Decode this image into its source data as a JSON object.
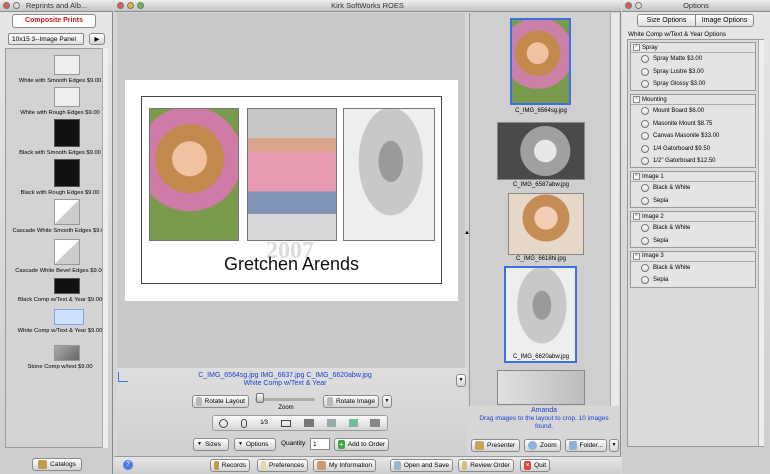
{
  "left_window": {
    "title": "Reprints and Alb...",
    "tab": "Composite Prints",
    "dropdown": "10x15 3--Image Panel",
    "catalogs_btn": "Catalogs",
    "items": [
      {
        "label": "White with Smooth Edges $9.00",
        "style": "white"
      },
      {
        "label": "White with Rough Edges $9.00",
        "style": "white"
      },
      {
        "label": "Black with Smooth Edges $9.00",
        "style": "black"
      },
      {
        "label": "Black with Rough Edges $9.00",
        "style": "black"
      },
      {
        "label": "Cascade White Smooth Edges $9.00",
        "style": "cascade"
      },
      {
        "label": "Cascade White Bevel Edges $9.00",
        "style": "cascade"
      },
      {
        "label": "Black Comp w/Text & Year $9.00",
        "style": "black-text"
      },
      {
        "label": "White Comp w/Text & Year $9.00",
        "style": "white-text"
      },
      {
        "label": "Stone Comp w/text $9.00",
        "style": "stone"
      }
    ]
  },
  "main_window": {
    "title": "Kirk SoftWorks ROES",
    "composite": {
      "name": "Gretchen Arends",
      "year": "2007"
    },
    "info": {
      "files": "C_IMG_6564sg.jpg  IMG_6637.jpg  C_IMG_6620abw.jpg",
      "layout": "White Comp w/Text & Year"
    },
    "controls": {
      "rotate_layout": "Rotate Layout",
      "zoom": "Zoom",
      "rotate_image": "Rotate Image",
      "sizes": "Sizes",
      "options": "Options",
      "quantity_label": "Quantity",
      "quantity": "1",
      "add_to_order": "Add to Order"
    },
    "strip": [
      {
        "label": "C_IMG_6564sg.jpg"
      },
      {
        "label": "C_IMG_6587abw.jpg"
      },
      {
        "label": "C_IMG_6618hi.jpg"
      },
      {
        "label": "C_IMG_6620abw.jpg"
      }
    ],
    "status": {
      "name": "Amanda",
      "text": "Drag images to the layout to crop. 10 images found."
    },
    "strip_buttons": {
      "presenter": "Presenter",
      "zoom": "Zoom",
      "folder": "Folder..."
    },
    "bottom": {
      "records": "Records",
      "preferences": "Preferences",
      "my_information": "My Information",
      "open_save": "Open and Save",
      "review_order": "Review Order",
      "quit": "Quit"
    }
  },
  "options_window": {
    "title": "Options",
    "tabs": [
      "Size Options",
      "Image Options"
    ],
    "section": "White Comp w/Text & Year Options",
    "groups": [
      {
        "name": "Spray",
        "options": [
          "Spray Matte $3.00",
          "Spray Lustre $3.00",
          "Spray Glossy $3.00"
        ]
      },
      {
        "name": "Mounting",
        "options": [
          "Mount Board  $6.00",
          "Masonite Mount $8.75",
          "Canvas Masonite $33.00",
          "1/4 Gatorboard $9.50",
          "1/2\" Gatorboard $12.50"
        ]
      },
      {
        "name": "Image 1",
        "options": [
          "Black & White",
          "Sepia"
        ]
      },
      {
        "name": "Image 2",
        "options": [
          "Black & White",
          "Sepia"
        ]
      },
      {
        "name": "Image 3",
        "options": [
          "Black & White",
          "Sepia"
        ]
      }
    ]
  }
}
